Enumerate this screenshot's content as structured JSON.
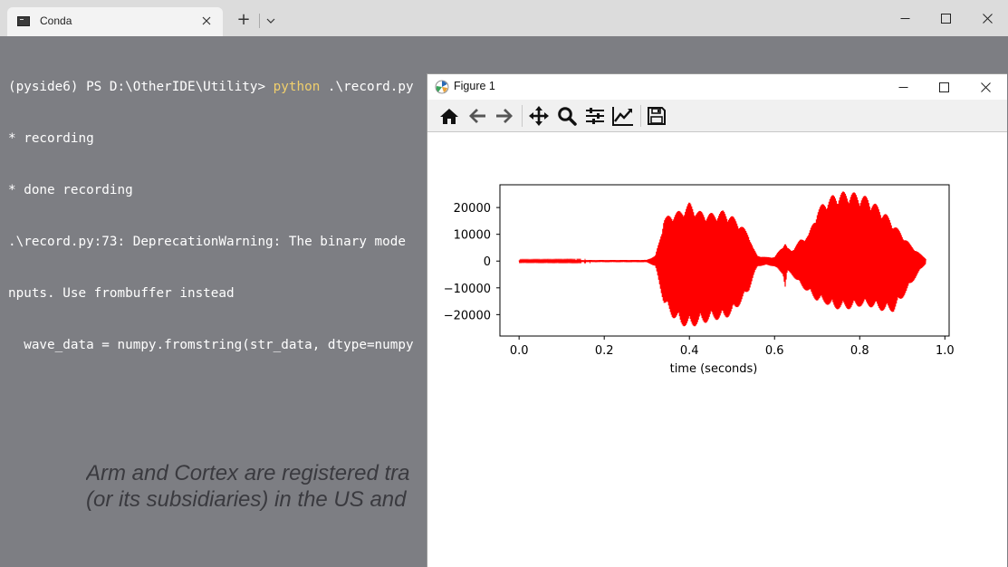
{
  "terminal": {
    "tab_title": "Conda",
    "new_tab_symbol": "+",
    "lines": [
      {
        "prompt": "(pyside6) PS D:\\OtherIDE\\Utility> ",
        "command": "python",
        "args": " .\\record.py"
      },
      {
        "text": "* recording"
      },
      {
        "text": "* done recording"
      },
      {
        "text": ".\\record.py:73: DeprecationWarning: The binary mode"
      },
      {
        "text": "nputs. Use frombuffer instead"
      },
      {
        "text": "  wave_data = numpy.fromstring(str_data, dtype=numpy"
      }
    ],
    "command_color": "#f0cf6c",
    "background_color": "#7d7e83"
  },
  "watermark": {
    "line1": "Arm and Cortex are registered tra",
    "line2": "(or its subsidiaries) in the US and"
  },
  "figure": {
    "title": "Figure 1",
    "toolbar": [
      "home-icon",
      "back-icon",
      "forward-icon",
      "pan-icon",
      "zoom-icon",
      "configure-subplots-icon",
      "edit-axis-icon",
      "save-icon"
    ]
  },
  "chart_data": {
    "type": "line",
    "title": "",
    "xlabel": "time (seconds)",
    "ylabel": "",
    "xlim": [
      -0.045,
      1.01
    ],
    "ylim": [
      -28000,
      28500
    ],
    "xticks": [
      0.0,
      0.2,
      0.4,
      0.6,
      0.8,
      1.0
    ],
    "xtick_labels": [
      "0.0",
      "0.2",
      "0.4",
      "0.6",
      "0.8",
      "1.0"
    ],
    "yticks": [
      20000,
      10000,
      0,
      -10000,
      -20000
    ],
    "ytick_labels": [
      "20000",
      "10000",
      "0",
      "−10000",
      "−20000"
    ],
    "grid": false,
    "series": [
      {
        "color": "#ff0000",
        "envelope": {
          "x": [
            0.0,
            0.3,
            0.32,
            0.33,
            0.34,
            0.36,
            0.38,
            0.4,
            0.42,
            0.44,
            0.46,
            0.48,
            0.5,
            0.52,
            0.54,
            0.55,
            0.56,
            0.58,
            0.6,
            0.62,
            0.625,
            0.63,
            0.64,
            0.66,
            0.68,
            0.7,
            0.72,
            0.74,
            0.76,
            0.78,
            0.8,
            0.82,
            0.84,
            0.86,
            0.88,
            0.9,
            0.92,
            0.94,
            0.955
          ],
          "max": [
            300,
            400,
            2000,
            8000,
            16000,
            18000,
            19000,
            22000,
            19000,
            18000,
            18000,
            19000,
            17000,
            14000,
            10000,
            5000,
            2000,
            1500,
            1500,
            6000,
            7000,
            5000,
            4000,
            8000,
            10000,
            19000,
            23000,
            25000,
            26000,
            26000,
            25000,
            24000,
            21000,
            18000,
            14000,
            10000,
            6000,
            3000,
            1000
          ],
          "min": [
            -300,
            -400,
            -2000,
            -9000,
            -16000,
            -21000,
            -24000,
            -25000,
            -24000,
            -23000,
            -22000,
            -22000,
            -20000,
            -16000,
            -11000,
            -6000,
            -2000,
            -1500,
            -2000,
            -5000,
            -10000,
            -4000,
            -5000,
            -9000,
            -12000,
            -15000,
            -16000,
            -18000,
            -18000,
            -18000,
            -17000,
            -17000,
            -18000,
            -19000,
            -19000,
            -14000,
            -9000,
            -4000,
            -1000
          ]
        }
      }
    ]
  }
}
